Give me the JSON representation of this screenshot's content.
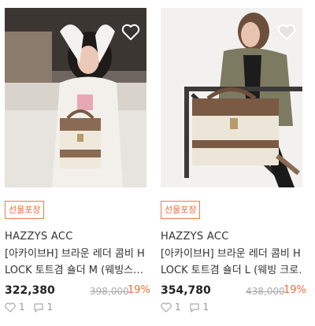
{
  "products": [
    {
      "badge": "선물포장",
      "brand": "HAZZYS ACC",
      "title_line1": "[아카이브H] 브라운 레더 콤비 H",
      "title_line2": "LOCK 토트겸 숄더 M (웨빙스…",
      "price": "322,380",
      "original_price": "398,000",
      "discount": "19%",
      "likes": "1",
      "reviews": "1",
      "photo_icon": "woman-holding-tote-bag-photo"
    },
    {
      "badge": "선물포장",
      "brand": "HAZZYS ACC",
      "title_line1": "[아카이브H] 브라운 레더 콤비 H",
      "title_line2": "LOCK 토트겸 숄더 L (웨빙 크로…",
      "price": "354,780",
      "original_price": "438,000",
      "discount": "19%",
      "likes": "1",
      "reviews": "1",
      "photo_icon": "woman-seated-with-tote-bag-photo"
    }
  ],
  "colors": {
    "accent": "#ef6b3c",
    "muted": "#999999"
  },
  "icons": {
    "wishlist": "heart-outline-icon",
    "likes": "heart-icon",
    "reviews": "comment-icon"
  }
}
